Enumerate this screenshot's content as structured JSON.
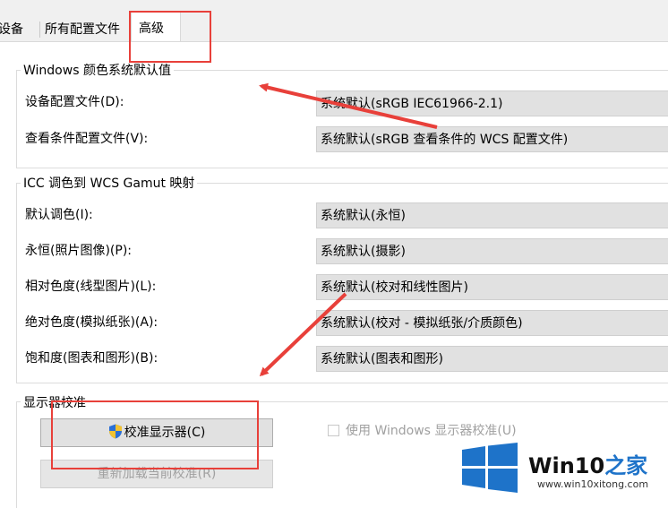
{
  "tabs": {
    "devices": "设备",
    "all_profiles": "所有配置文件",
    "advanced": "高级"
  },
  "windows_defaults": {
    "title": "Windows 颜色系统默认值",
    "device_profile_label": "设备配置文件(D):",
    "device_profile_value": "系统默认(sRGB IEC61966-2.1)",
    "viewing_conditions_label": "查看条件配置文件(V):",
    "viewing_conditions_value": "系统默认(sRGB 查看条件的 WCS 配置文件)"
  },
  "gamut_mapping": {
    "title": "ICC 调色到 WCS Gamut 映射",
    "rows": [
      {
        "label": "默认调色(I):",
        "value": "系统默认(永恒)"
      },
      {
        "label": "永恒(照片图像)(P):",
        "value": "系统默认(摄影)"
      },
      {
        "label": "相对色度(线型图片)(L):",
        "value": "系统默认(校对和线性图片)"
      },
      {
        "label": "绝对色度(模拟纸张)(A):",
        "value": "系统默认(校对 - 模拟纸张/介质颜色)"
      },
      {
        "label": "饱和度(图表和图形)(B):",
        "value": "系统默认(图表和图形)"
      }
    ]
  },
  "display_calibration": {
    "title": "显示器校准",
    "calibrate_button": "校准显示器(C)",
    "use_windows_calibration": "使用 Windows 显示器校准(U)",
    "reload_button": "重新加载当前校准(R)"
  },
  "watermark": {
    "brand": "Win10",
    "brand_suffix": "之家",
    "url": "www.win10xitong.com"
  },
  "colors": {
    "annotation_red": "#e8403a",
    "brand_blue": "#1e73c9"
  }
}
